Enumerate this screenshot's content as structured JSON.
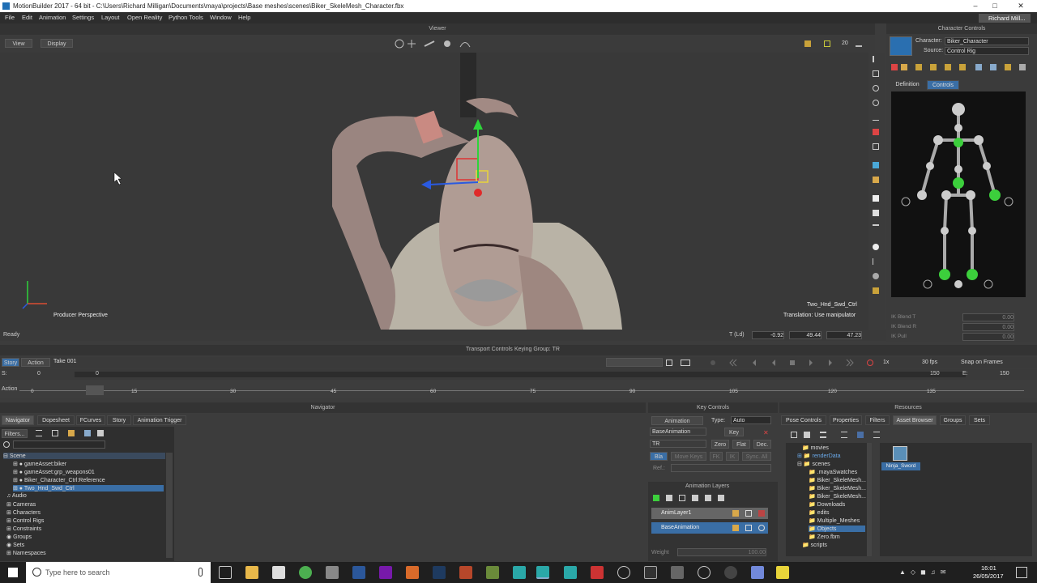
{
  "title": "MotionBuilder 2017  - 64 bit  - C:\\Users\\Richard Milligan\\Documents\\maya\\projects\\Base meshes\\scenes\\Biker_SkeleMesh_Character.fbx",
  "menu": [
    "File",
    "Edit",
    "Animation",
    "Settings",
    "Layout",
    "Open Reality",
    "Python Tools",
    "Window",
    "Help"
  ],
  "user": "Richard Mill...",
  "viewer": {
    "header": "Viewer",
    "view_btn": "View",
    "display_btn": "Display",
    "camera_label": "Producer Perspective",
    "object_label": "Two_Hnd_Swd_Ctrl",
    "translation_label": "Translation: Use manipulator",
    "zoom": "20"
  },
  "status": {
    "ready": "Ready",
    "t_label": "T (Ld)",
    "x": "-0.92",
    "y": "49.44",
    "z": "47.23"
  },
  "char_controls": {
    "header": "Character Controls",
    "character_label": "Character:",
    "character_value": "Biker_Character",
    "source_label": "Source:",
    "source_value": "Control Rig",
    "tab_definition": "Definition",
    "tab_controls": "Controls",
    "ik1": "IK Blend T",
    "ik2": "IK Blend R",
    "ik3": "IK Pull",
    "ikv1": "0.00",
    "ikv2": "0.00",
    "ikv3": "0.00"
  },
  "transport": {
    "header": "Transport Controls",
    "keying": "Keying Group: TR",
    "story": "Story",
    "action": "Action",
    "take": "Take 001",
    "speed": "1x",
    "fps": "30 fps",
    "snap": "Snap on Frames",
    "s_label": "S:",
    "s_val": "0",
    "cur": "0",
    "e_label": "E:",
    "e_val": "150",
    "end": "150",
    "action_lbl": "Action",
    "ticks": [
      "0",
      "15",
      "30",
      "45",
      "60",
      "75",
      "90",
      "105",
      "120",
      "135"
    ]
  },
  "navigator": {
    "header": "Navigator",
    "tabs": [
      "Navigator",
      "Dopesheet",
      "FCurves",
      "Story",
      "Animation Trigger"
    ],
    "filters": "Filters...",
    "tree": [
      "Scene",
      "gameAsset:biker",
      "gameAsset:grp_weapons01",
      "Biker_Character_Ctrl:Reference",
      "Two_Hnd_Swd_Ctrl",
      "Audio",
      "Cameras",
      "Characters",
      "Control Rigs",
      "Constraints",
      "Groups",
      "Sets",
      "Namespaces"
    ]
  },
  "key_controls": {
    "header": "Key Controls",
    "animation": "Animation",
    "type_label": "Type:",
    "type_value": "Auto",
    "layer": "BaseAnimation",
    "key": "Key",
    "tr": "TR",
    "zero": "Zero",
    "flat": "Flat",
    "dec": "Dec.",
    "btns": [
      "Bla",
      "Move Keys",
      "FK",
      "IK",
      "Sync. All"
    ],
    "ref": "Ref.:",
    "anim_layers": "Animation Layers",
    "layers": [
      "AnimLayer1",
      "BaseAnimation"
    ],
    "weight": "Weight",
    "weight_val": "100.00"
  },
  "resources": {
    "header": "Resources",
    "tabs": [
      "Pose Controls",
      "Properties",
      "Filters",
      "Asset Browser",
      "Groups",
      "Sets"
    ],
    "folders": [
      "movies",
      "renderData",
      "scenes",
      ".mayaSwatches",
      "Biker_SkeleMesh...",
      "Biker_SkeleMesh...",
      "Biker_SkeleMesh...",
      "Downloads",
      "edits",
      "Multiple_Meshes",
      "Objects",
      "Zero.fbm",
      "scripts"
    ],
    "asset": "Ninja_Sword"
  },
  "taskbar": {
    "search": "Type here to search",
    "time": "16:01",
    "date": "26/05/2017"
  },
  "colors": {
    "accent": "#4a6fa5",
    "green": "#3ccf3c",
    "select": "#3a6ea5"
  }
}
